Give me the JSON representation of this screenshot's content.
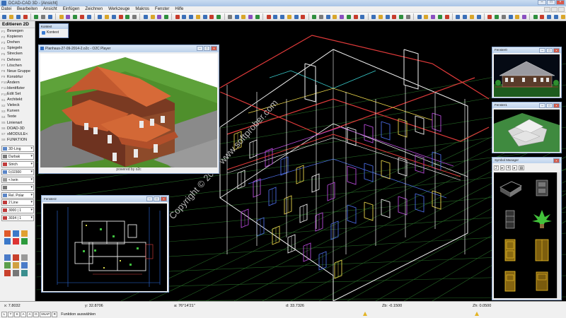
{
  "window": {
    "title": "DCAD-CAD 3D - [Ansicht]"
  },
  "menu": [
    "Datei",
    "Bearbeiten",
    "Ansicht",
    "Einfügen",
    "Zeichnen",
    "Werkzeuge",
    "Makros",
    "Fenster",
    "Hilfe"
  ],
  "left_panel": {
    "header": "Editieren 2D",
    "items": [
      {
        "key": "F1",
        "label": "Bewegen"
      },
      {
        "key": "F2",
        "label": "Kopieren"
      },
      {
        "key": "F3",
        "label": "Drehen"
      },
      {
        "key": "F4",
        "label": "Spiegeln"
      },
      {
        "key": "F5",
        "label": "Strecken"
      },
      {
        "key": "F6",
        "label": "Dehnen"
      },
      {
        "key": "F7",
        "label": "Löschen"
      },
      {
        "key": "F8",
        "label": "Neue Gruppe"
      },
      {
        "key": "F9",
        "label": "Konstrtur"
      },
      {
        "key": "F10",
        "label": "Ändern"
      },
      {
        "key": "F11",
        "label": "Identifizier"
      },
      {
        "key": "F12",
        "label": "Edit Set"
      },
      {
        "key": "S1",
        "label": "Architekt"
      },
      {
        "key": "S2",
        "label": "Vieleck"
      },
      {
        "key": "S3",
        "label": "Kurven"
      },
      {
        "key": "S4",
        "label": "Texte"
      },
      {
        "key": "S5",
        "label": "Linienart"
      },
      {
        "key": "S6",
        "label": "DOAD-3D"
      },
      {
        "key": "S7",
        "label": "xMODULE<"
      },
      {
        "key": "S8",
        "label": "FUNKTION"
      }
    ],
    "controls": [
      "3D-Ling",
      "Durbak",
      "Strich",
      "0,02300",
      "< kein",
      "",
      "Rel. Polar"
    ],
    "lines": [
      "2 Line",
      "3000 | 1",
      "3034 | 1"
    ]
  },
  "kontext": {
    "title": "Kontext",
    "label": "Kontext"
  },
  "o2c": {
    "title": "Planhaus-27-09-2014-2.o2c - O2C Player",
    "powered": "powered by o2c"
  },
  "fenster2": {
    "title": "Fenster2"
  },
  "fenster0": {
    "title": "Fenster0"
  },
  "fenster1": {
    "title": "Fenster1"
  },
  "symbol_manager": {
    "title": "Symbol Manager",
    "tb1": "2",
    "tb2": "4"
  },
  "watermark": "Copyright © 2017 www.softprober.com",
  "status": {
    "x": "x: 7.8032",
    "y": "y: 32.8706",
    "angle": "a: 76°14'21\"",
    "d": "d: 33.7326",
    "zb": "Zb: -0.1500",
    "zh": "Zh: 0.0500",
    "buttons": [
      "L",
      "T",
      "S",
      "A",
      "A",
      "G",
      "SNAP",
      "R"
    ],
    "message": "Funktion auswählen"
  }
}
